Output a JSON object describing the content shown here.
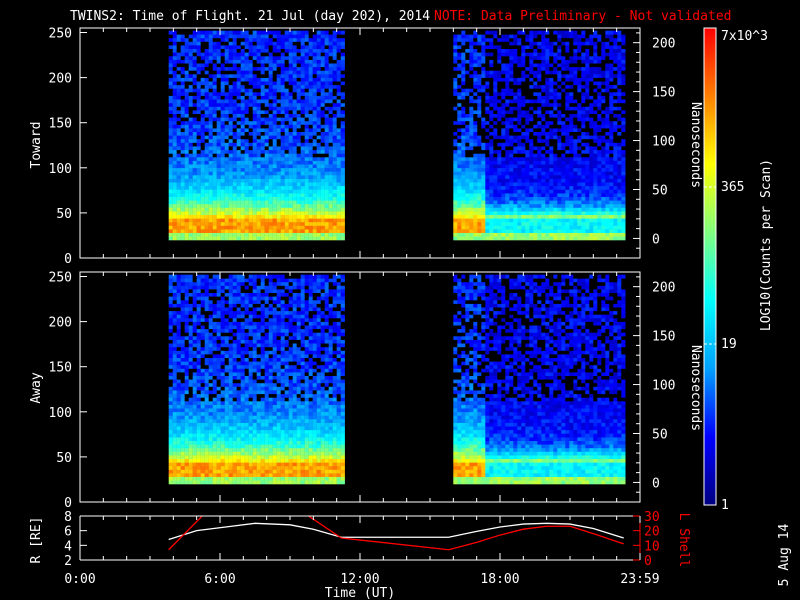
{
  "title": {
    "main": "TWINS2: Time of Flight. 21 Jul (day 202), 2014",
    "note": "NOTE: Data Preliminary - Not validated",
    "note_color": "#ff0000"
  },
  "chart_data": [
    {
      "type": "heatmap",
      "panel": "Toward",
      "ylabel": "Toward",
      "ylabel_right": "Nanoseconds",
      "ylim": [
        0,
        255
      ],
      "yticks": [
        "0",
        "50",
        "100",
        "150",
        "200",
        "250"
      ],
      "ylim_right": [
        -20,
        215
      ],
      "yticks_right": [
        "0",
        "50",
        "100",
        "150",
        "200"
      ],
      "data_intervals_hours": [
        [
          3.8,
          11.2
        ],
        [
          16.0,
          23.3
        ]
      ],
      "peak_channel_range": [
        25,
        40
      ]
    },
    {
      "type": "heatmap",
      "panel": "Away",
      "ylabel": "Away",
      "ylabel_right": "Nanoseconds",
      "ylim": [
        0,
        255
      ],
      "yticks": [
        "0",
        "50",
        "100",
        "150",
        "200",
        "250"
      ],
      "ylim_right": [
        -20,
        215
      ],
      "yticks_right": [
        "0",
        "50",
        "100",
        "150",
        "200"
      ],
      "data_intervals_hours": [
        [
          3.8,
          11.2
        ],
        [
          16.0,
          23.3
        ]
      ],
      "peak_channel_range": [
        25,
        40
      ]
    },
    {
      "type": "line",
      "ylabel": "R [RE]",
      "ylabel_right": "L Shell",
      "ylim": [
        2,
        8
      ],
      "yticks": [
        "2",
        "4",
        "6",
        "8"
      ],
      "ylim_right": [
        0,
        30
      ],
      "yticks_right": [
        "0",
        "10",
        "20",
        "30"
      ],
      "series": [
        {
          "name": "R",
          "color": "#ffffff",
          "x": [
            3.8,
            5,
            6.5,
            7.5,
            9,
            10,
            11.2,
            15.8,
            17,
            18,
            19,
            20,
            21,
            22,
            23.3
          ],
          "y": [
            4.8,
            6,
            6.6,
            7,
            6.8,
            6.2,
            5.1,
            5.1,
            5.9,
            6.5,
            6.9,
            7,
            6.9,
            6.3,
            5.0
          ]
        },
        {
          "name": "L Shell",
          "color": "#ff0000",
          "segments": [
            {
              "x": [
                3.8,
                5.3
              ],
              "y": [
                7,
                31
              ]
            },
            {
              "x": [
                9.7,
                11.2,
                15.8,
                17,
                18,
                19,
                20,
                21,
                22,
                23.3
              ],
              "y": [
                31,
                15,
                7,
                12,
                17,
                21,
                23,
                23,
                18,
                11
              ]
            }
          ]
        }
      ]
    }
  ],
  "xaxis": {
    "label": "Time (UT)",
    "ticks": [
      "0:00",
      "6:00",
      "12:00",
      "18:00",
      "23:59"
    ],
    "range_hours": [
      0,
      24
    ]
  },
  "colorbar": {
    "label": "LOG10(Counts per Scan)",
    "ticks": [
      "1",
      "19",
      "365",
      "7x10^3"
    ],
    "tick_labels": {
      "max_base": "7x",
      "max_sub": "10",
      "max_sup": "3"
    },
    "colors": [
      "#000080",
      "#0000ff",
      "#00a0ff",
      "#00ffff",
      "#80ff80",
      "#ffff00",
      "#ff8000",
      "#ff0000"
    ]
  },
  "date_stamp": "5 Aug 14"
}
